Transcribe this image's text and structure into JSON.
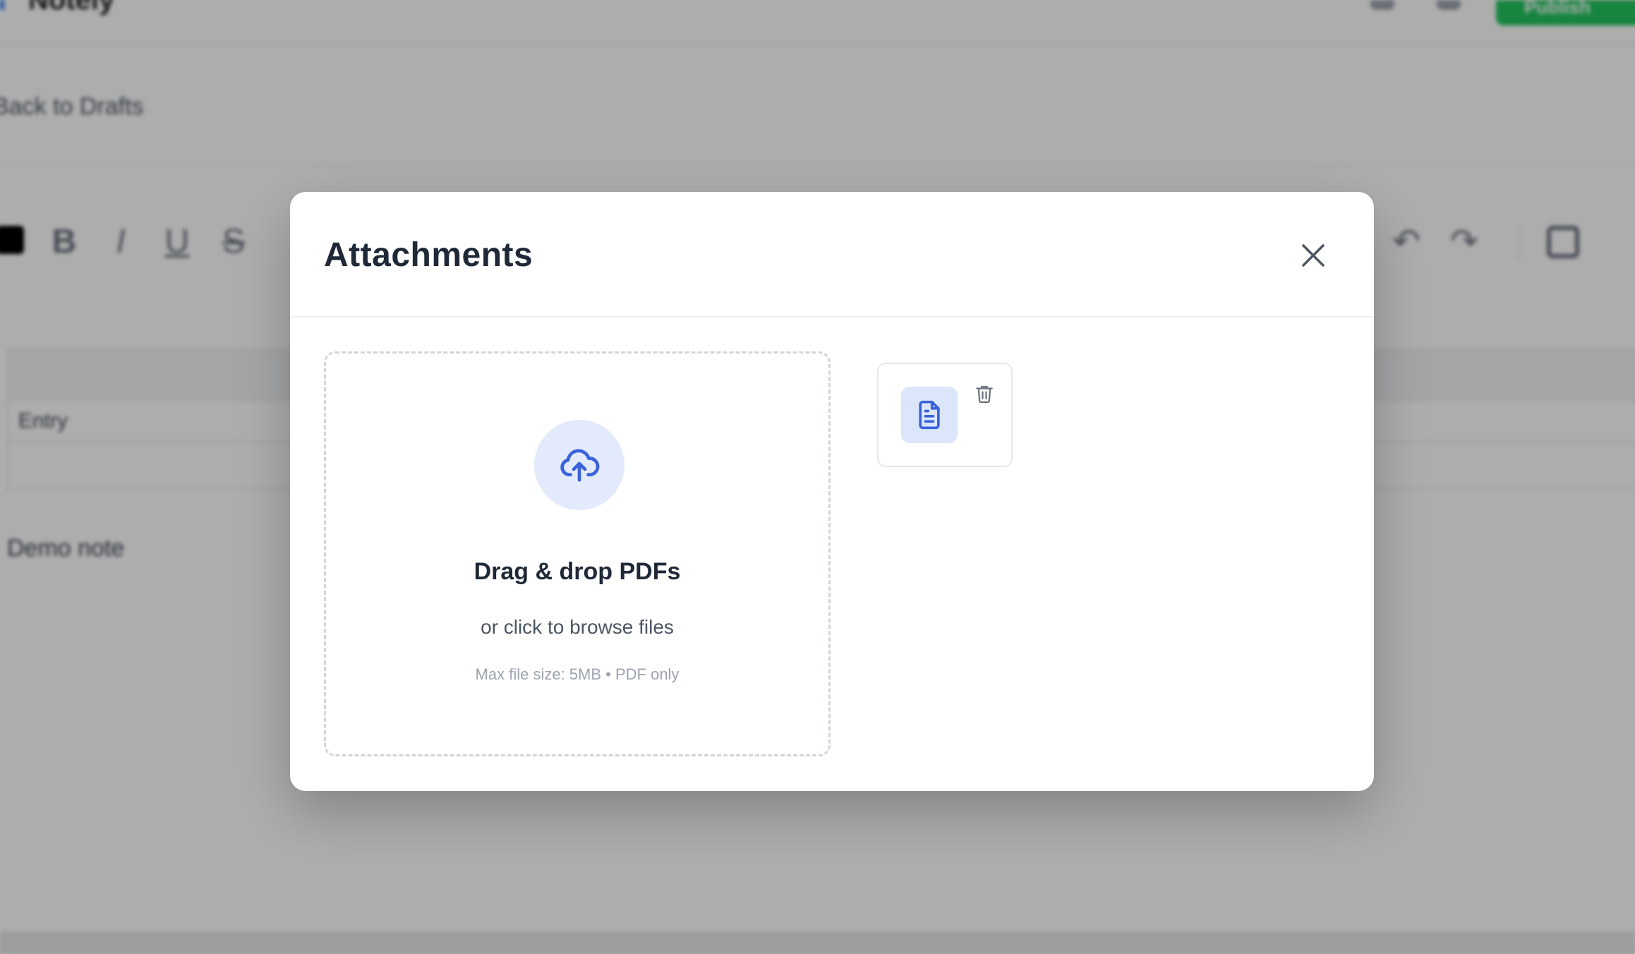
{
  "background": {
    "app_title": "Notely",
    "back_link": "Back to Drafts",
    "publish_label": "Publish",
    "table_cell": "Entry",
    "note_text": "Demo note"
  },
  "modal": {
    "title": "Attachments",
    "close_icon": "close-icon",
    "dropzone": {
      "icon": "cloud-upload-icon",
      "title": "Drag & drop PDFs",
      "subtitle": "or click to browse files",
      "hint": "Max file size: 5MB • PDF only"
    },
    "files": [
      {
        "icon": "file-document-icon",
        "delete_icon": "trash-icon"
      }
    ]
  },
  "colors": {
    "accent": "#3b63d9",
    "accent_soft": "#e2eafc",
    "text_primary": "#1f2937",
    "text_secondary": "#4b5563",
    "text_muted": "#9ca3af",
    "overlay": "rgba(0,0,0,0.32)"
  }
}
